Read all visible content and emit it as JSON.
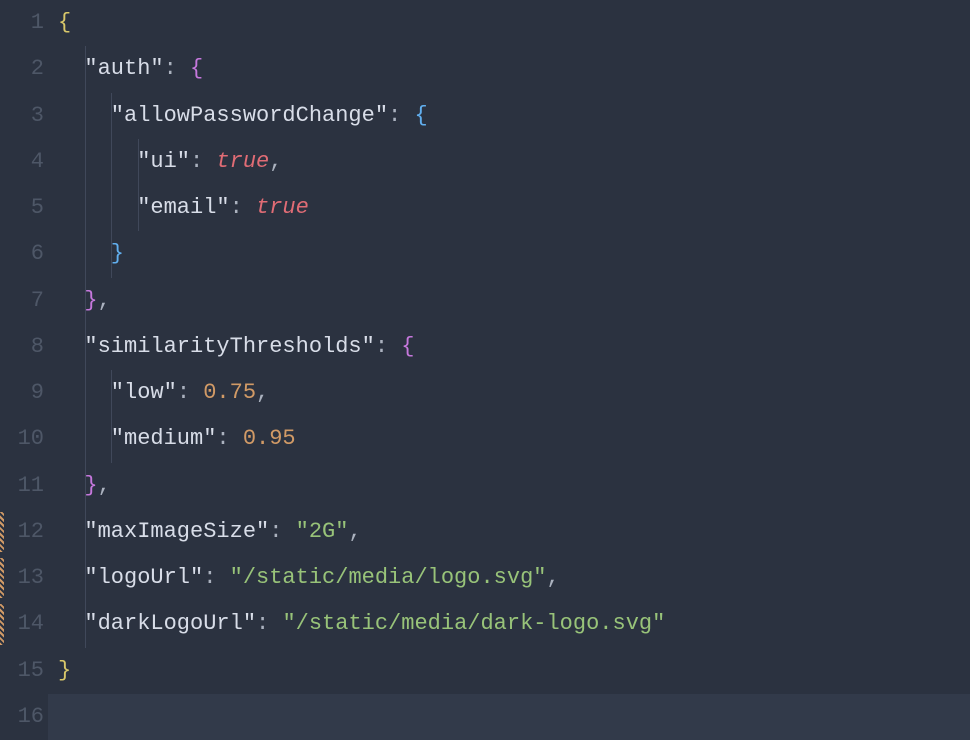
{
  "lineNumbers": [
    "1",
    "2",
    "3",
    "4",
    "5",
    "6",
    "7",
    "8",
    "9",
    "10",
    "11",
    "12",
    "13",
    "14",
    "15",
    "16"
  ],
  "modifiedLines": [
    12,
    13,
    14
  ],
  "currentLine": 16,
  "indentGuideColumns": [
    2,
    4,
    6
  ],
  "lines": {
    "l1": {
      "indent": 0,
      "tokens": [
        [
          "{",
          "brace-y"
        ]
      ]
    },
    "l2": {
      "indent": 2,
      "guides": [
        2
      ],
      "tokens": [
        [
          "\"auth\"",
          "key"
        ],
        [
          ":",
          "punc"
        ],
        [
          " ",
          ""
        ],
        [
          "{",
          "brace-m"
        ]
      ]
    },
    "l3": {
      "indent": 4,
      "guides": [
        2,
        4
      ],
      "tokens": [
        [
          "\"allowPasswordChange\"",
          "key"
        ],
        [
          ":",
          "punc"
        ],
        [
          " ",
          ""
        ],
        [
          "{",
          "brace-b"
        ]
      ]
    },
    "l4": {
      "indent": 6,
      "guides": [
        2,
        4,
        6
      ],
      "tokens": [
        [
          "\"ui\"",
          "key"
        ],
        [
          ":",
          "punc"
        ],
        [
          " ",
          ""
        ],
        [
          "true",
          "bool"
        ],
        [
          ",",
          "comma"
        ]
      ]
    },
    "l5": {
      "indent": 6,
      "guides": [
        2,
        4,
        6
      ],
      "tokens": [
        [
          "\"email\"",
          "key"
        ],
        [
          ":",
          "punc"
        ],
        [
          " ",
          ""
        ],
        [
          "true",
          "bool"
        ]
      ]
    },
    "l6": {
      "indent": 4,
      "guides": [
        2,
        4
      ],
      "tokens": [
        [
          "}",
          "brace-b"
        ]
      ]
    },
    "l7": {
      "indent": 2,
      "guides": [
        2
      ],
      "tokens": [
        [
          "}",
          "brace-m"
        ],
        [
          ",",
          "comma"
        ]
      ]
    },
    "l8": {
      "indent": 2,
      "guides": [
        2
      ],
      "tokens": [
        [
          "\"similarityThresholds\"",
          "key"
        ],
        [
          ":",
          "punc"
        ],
        [
          " ",
          ""
        ],
        [
          "{",
          "brace-m"
        ]
      ]
    },
    "l9": {
      "indent": 4,
      "guides": [
        2,
        4
      ],
      "tokens": [
        [
          "\"low\"",
          "key"
        ],
        [
          ":",
          "punc"
        ],
        [
          " ",
          ""
        ],
        [
          "0.75",
          "num"
        ],
        [
          ",",
          "comma"
        ]
      ]
    },
    "l10": {
      "indent": 4,
      "guides": [
        2,
        4
      ],
      "tokens": [
        [
          "\"medium\"",
          "key"
        ],
        [
          ":",
          "punc"
        ],
        [
          " ",
          ""
        ],
        [
          "0.95",
          "num"
        ]
      ]
    },
    "l11": {
      "indent": 2,
      "guides": [
        2
      ],
      "tokens": [
        [
          "}",
          "brace-m"
        ],
        [
          ",",
          "comma"
        ]
      ]
    },
    "l12": {
      "indent": 2,
      "guides": [
        2
      ],
      "tokens": [
        [
          "\"maxImageSize\"",
          "key"
        ],
        [
          ":",
          "punc"
        ],
        [
          " ",
          ""
        ],
        [
          "\"2G\"",
          "str"
        ],
        [
          ",",
          "comma"
        ]
      ]
    },
    "l13": {
      "indent": 2,
      "guides": [
        2
      ],
      "tokens": [
        [
          "\"logoUrl\"",
          "key"
        ],
        [
          ":",
          "punc"
        ],
        [
          " ",
          ""
        ],
        [
          "\"/static/media/logo.svg\"",
          "str"
        ],
        [
          ",",
          "comma"
        ]
      ]
    },
    "l14": {
      "indent": 2,
      "guides": [
        2
      ],
      "tokens": [
        [
          "\"darkLogoUrl\"",
          "key"
        ],
        [
          ":",
          "punc"
        ],
        [
          " ",
          ""
        ],
        [
          "\"/static/media/dark-logo.svg\"",
          "str"
        ]
      ]
    },
    "l15": {
      "indent": 0,
      "tokens": [
        [
          "}",
          "brace-y"
        ]
      ]
    },
    "l16": {
      "indent": 0,
      "tokens": []
    }
  }
}
